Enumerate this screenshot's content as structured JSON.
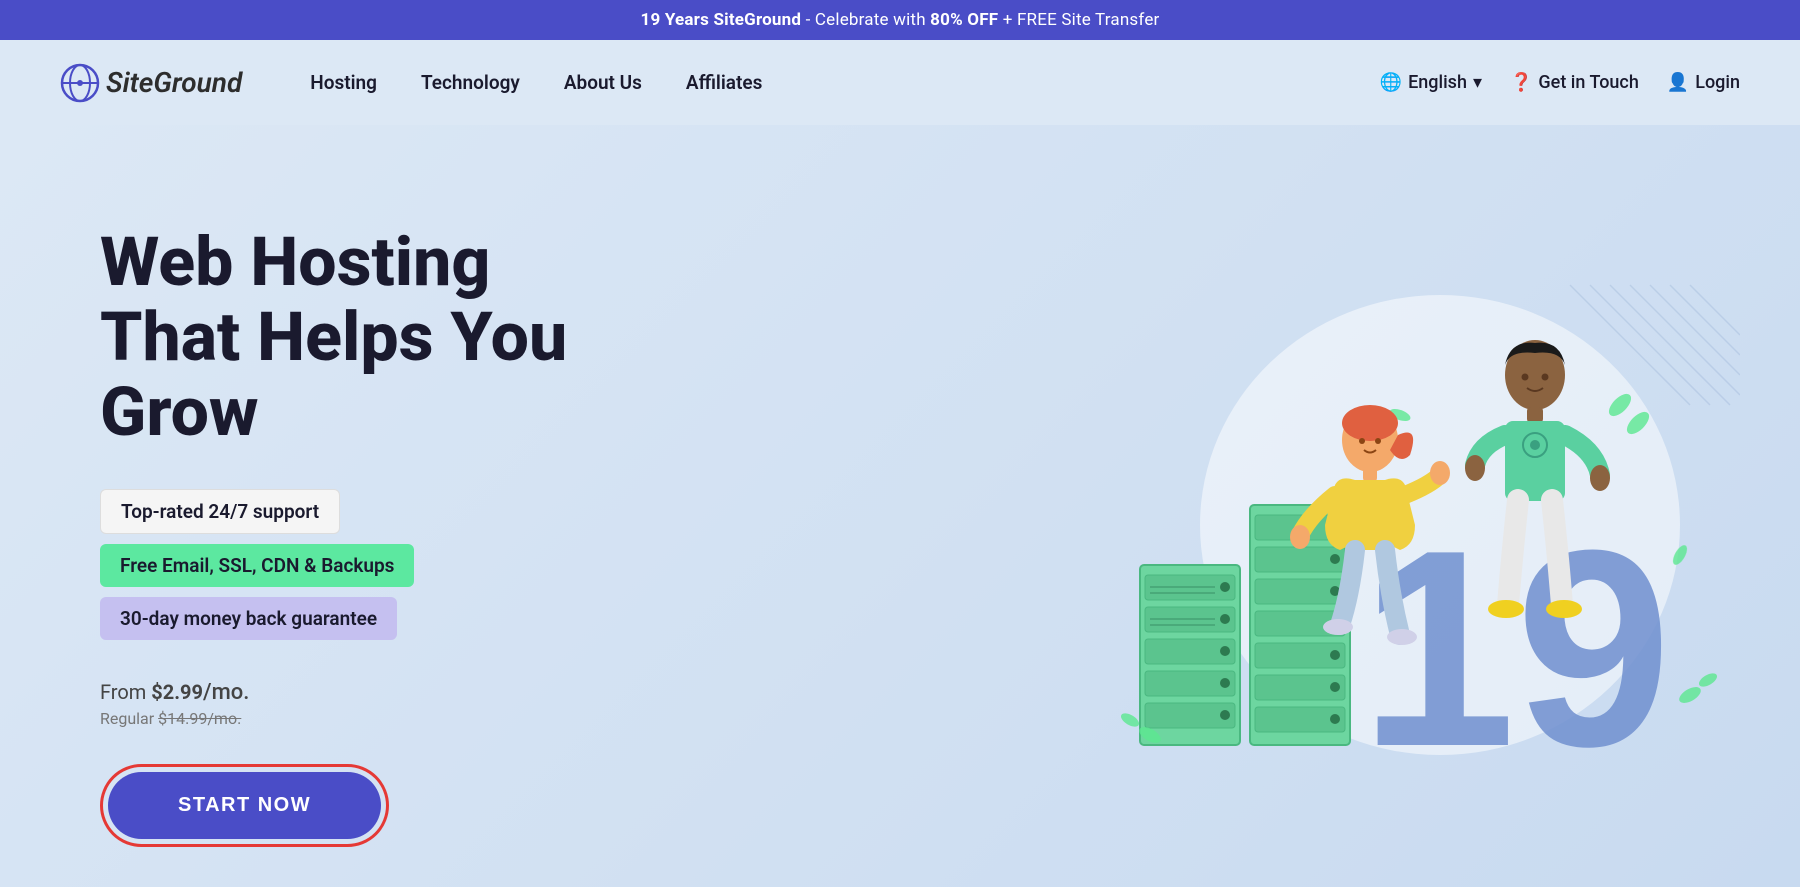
{
  "banner": {
    "text_1": "19 Years SiteGround",
    "text_2": " - Celebrate with ",
    "text_highlight": "80% OFF",
    "text_3": " + FREE Site Transfer"
  },
  "nav": {
    "logo_text": "SiteGround",
    "links": [
      {
        "label": "Hosting",
        "id": "hosting"
      },
      {
        "label": "Technology",
        "id": "technology"
      },
      {
        "label": "About Us",
        "id": "about-us"
      },
      {
        "label": "Affiliates",
        "id": "affiliates"
      }
    ],
    "right": [
      {
        "label": "English",
        "id": "language",
        "icon": "🌐"
      },
      {
        "label": "Get in Touch",
        "id": "contact",
        "icon": "❓"
      },
      {
        "label": "Login",
        "id": "login",
        "icon": "👤"
      }
    ]
  },
  "hero": {
    "title_line1": "Web Hosting",
    "title_line2": "That Helps You Grow",
    "features": [
      {
        "label": "Top-rated 24/7 support",
        "style": "plain"
      },
      {
        "label": "Free Email, SSL, CDN & Backups",
        "style": "green"
      },
      {
        "label": "30-day money back guarantee",
        "style": "purple"
      }
    ],
    "pricing": {
      "from_label": "From",
      "amount": "$2.99",
      "per": "/mo.",
      "regular_label": "Regular",
      "regular_price": "$14.99/mo."
    },
    "cta_button": "START NOW"
  }
}
